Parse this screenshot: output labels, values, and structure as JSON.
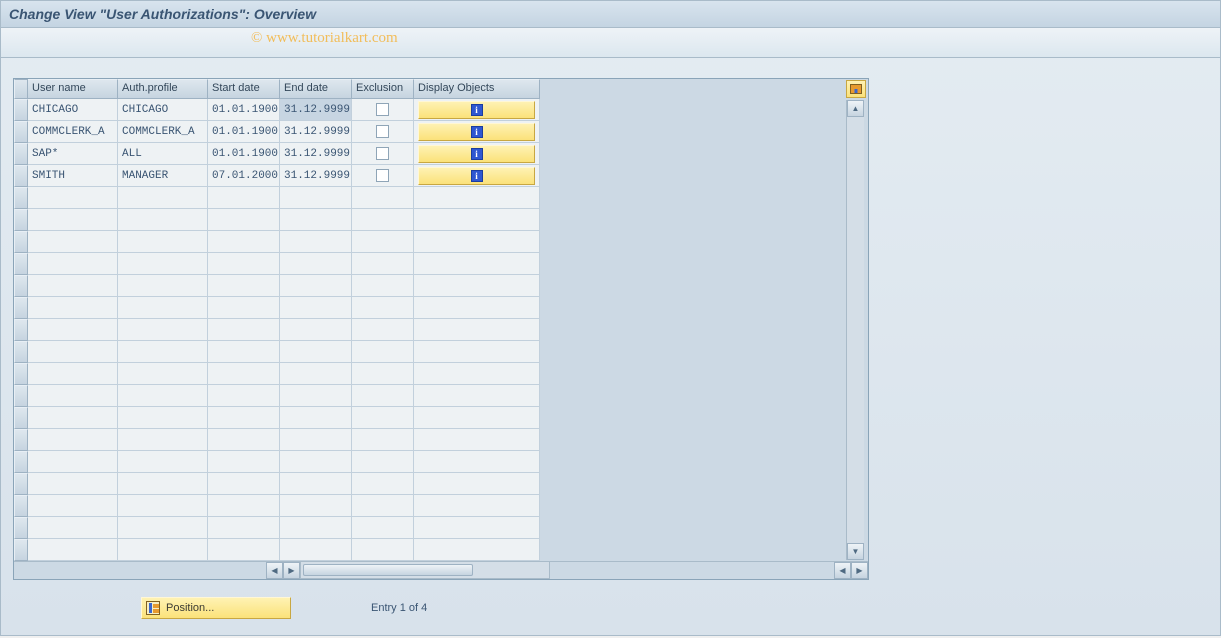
{
  "title": "Change View \"User Authorizations\": Overview",
  "watermark": "© www.tutorialkart.com",
  "columns": {
    "user": "User name",
    "profile": "Auth.profile",
    "start": "Start date",
    "end": "End date",
    "excl": "Exclusion",
    "disp": "Display Objects"
  },
  "rows": [
    {
      "user": "CHICAGO",
      "profile": "CHICAGO",
      "start": "01.01.1900",
      "end": "31.12.9999",
      "excl": false
    },
    {
      "user": "COMMCLERK_A",
      "profile": "COMMCLERK_A",
      "start": "01.01.1900",
      "end": "31.12.9999",
      "excl": false
    },
    {
      "user": "SAP*",
      "profile": "ALL",
      "start": "01.01.1900",
      "end": "31.12.9999",
      "excl": false
    },
    {
      "user": "SMITH",
      "profile": "MANAGER",
      "start": "07.01.2000",
      "end": "31.12.9999",
      "excl": false
    }
  ],
  "empty_row_count": 17,
  "footer": {
    "position_label": "Position...",
    "entry_text": "Entry 1 of 4"
  },
  "icons": {
    "info": "i",
    "up": "▲",
    "down": "▼",
    "left": "◀",
    "right": "▶"
  }
}
